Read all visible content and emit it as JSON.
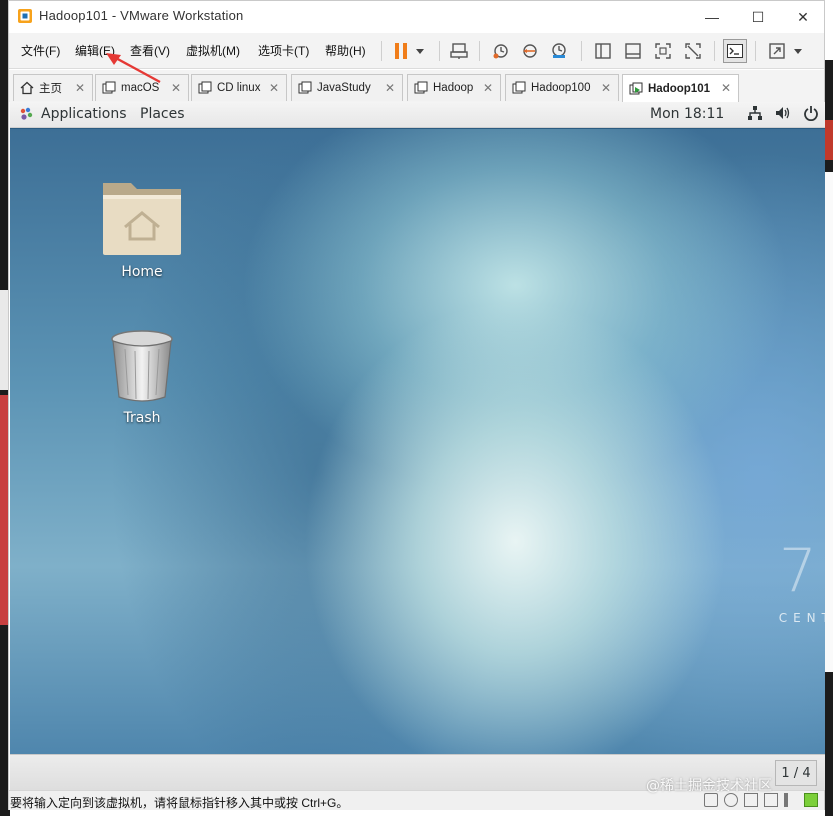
{
  "window": {
    "title": "Hadoop101 - VMware Workstation",
    "controls": {
      "minimize": "—",
      "maximize": "☐",
      "close": "✕"
    }
  },
  "menubar": {
    "items": [
      {
        "label": "文件(F)"
      },
      {
        "label": "编辑(E)"
      },
      {
        "label": "查看(V)"
      },
      {
        "label": "虚拟机(M)"
      },
      {
        "label": "选项卡(T)"
      },
      {
        "label": "帮助(H)"
      }
    ],
    "toolbar_icons": [
      "pause-icon",
      "dropdown-icon",
      "send-ctrl-alt-del-icon",
      "snapshot-icon",
      "revert-snapshot-icon",
      "snapshot-manager-icon",
      "library-icon",
      "thumbnail-icon",
      "fullscreen-icon",
      "unity-icon",
      "console-icon",
      "stretch-icon",
      "dropdown-icon"
    ],
    "accent_pause": "#f07d1a"
  },
  "tabs": [
    {
      "label": "主页",
      "icon": "home-icon",
      "active": false
    },
    {
      "label": "macOS",
      "icon": "vm-icon",
      "active": false
    },
    {
      "label": "CD linux",
      "icon": "vm-icon",
      "active": false
    },
    {
      "label": "JavaStudy",
      "icon": "vm-icon",
      "active": false
    },
    {
      "label": "Hadoop",
      "icon": "vm-icon",
      "active": false
    },
    {
      "label": "Hadoop100",
      "icon": "vm-icon",
      "active": false
    },
    {
      "label": "Hadoop101",
      "icon": "vm-running-icon",
      "active": true
    }
  ],
  "guest": {
    "topbar": {
      "applications": "Applications",
      "places": "Places",
      "clock": "Mon 18:11",
      "icons": [
        "network-icon",
        "volume-icon",
        "power-icon"
      ]
    },
    "desktop_icons": [
      {
        "label": "Home",
        "icon": "home-folder-icon"
      },
      {
        "label": "Trash",
        "icon": "trash-icon"
      }
    ],
    "branding": {
      "numeral": "7",
      "word": "CENT"
    },
    "workspace": "1 / 4"
  },
  "statusbar": {
    "text": "要将输入定向到该虚拟机，请将鼠标指针移入其中或按 Ctrl+G。",
    "watermark": "@稀土掘金技术社区"
  },
  "colors": {
    "annotation": "#e53935",
    "desktop_base": "#3d6f96"
  }
}
